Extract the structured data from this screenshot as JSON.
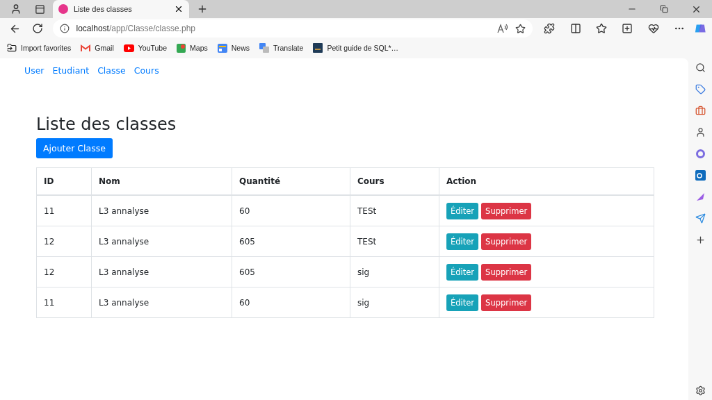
{
  "browser": {
    "tab": {
      "title": "Liste des classes"
    },
    "address": {
      "host": "localhost",
      "path": "/app/Classe/classe.php"
    },
    "bookmarks": [
      {
        "label": "Import favorites",
        "kind": "import"
      },
      {
        "label": "Gmail",
        "kind": "gmail"
      },
      {
        "label": "YouTube",
        "kind": "youtube"
      },
      {
        "label": "Maps",
        "kind": "maps"
      },
      {
        "label": "News",
        "kind": "news"
      },
      {
        "label": "Translate",
        "kind": "translate"
      },
      {
        "label": "Petit guide de SQL*…",
        "kind": "guide"
      }
    ]
  },
  "nav": [
    "User",
    "Etudiant",
    "Classe",
    "Cours"
  ],
  "heading": "Liste des classes",
  "add_button": "Ajouter Classe",
  "table": {
    "columns": [
      "ID",
      "Nom",
      "Quantité",
      "Cours",
      "Action"
    ],
    "rows": [
      {
        "id": "11",
        "nom": "L3 annalyse",
        "quantite": "60",
        "cours": "TESt",
        "edit": "Éditer",
        "delete": "Supprimer"
      },
      {
        "id": "12",
        "nom": "L3 annalyse",
        "quantite": "605",
        "cours": "TESt",
        "edit": "Éditer",
        "delete": "Supprimer"
      },
      {
        "id": "12",
        "nom": "L3 annalyse",
        "quantite": "605",
        "cours": "sig",
        "edit": "Éditer",
        "delete": "Supprimer"
      },
      {
        "id": "11",
        "nom": "L3 annalyse",
        "quantite": "60",
        "cours": "sig",
        "edit": "Éditer",
        "delete": "Supprimer"
      }
    ]
  }
}
